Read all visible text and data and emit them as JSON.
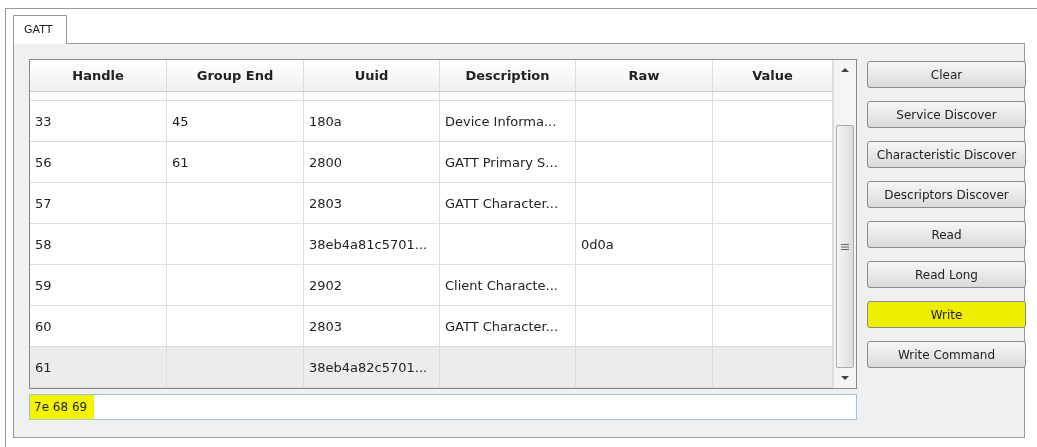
{
  "tabs": [
    {
      "label": "GATT",
      "selected": true
    }
  ],
  "table": {
    "columns": [
      "Handle",
      "Group End",
      "Uuid",
      "Description",
      "Raw",
      "Value"
    ],
    "rows": [
      {
        "cells": [
          "33",
          "45",
          "180a",
          "Device Informa...",
          "",
          ""
        ],
        "selected": false
      },
      {
        "cells": [
          "56",
          "61",
          "2800",
          "GATT Primary S...",
          "",
          ""
        ],
        "selected": false
      },
      {
        "cells": [
          "57",
          "",
          "2803",
          "GATT Character...",
          "",
          ""
        ],
        "selected": false
      },
      {
        "cells": [
          "58",
          "",
          "38eb4a81c5701...",
          "",
          "0d0a",
          ""
        ],
        "selected": false
      },
      {
        "cells": [
          "59",
          "",
          "2902",
          "Client Characte...",
          "",
          ""
        ],
        "selected": false
      },
      {
        "cells": [
          "60",
          "",
          "2803",
          "GATT Character...",
          "",
          ""
        ],
        "selected": false
      },
      {
        "cells": [
          "61",
          "",
          "38eb4a82c5701...",
          "",
          "",
          ""
        ],
        "selected": true
      }
    ]
  },
  "input": {
    "value": "7e 68 69",
    "highlighted": true
  },
  "buttons": [
    {
      "label": "Clear",
      "highlighted": false
    },
    {
      "label": "Service Discover",
      "highlighted": false
    },
    {
      "label": "Characteristic Discover",
      "highlighted": false
    },
    {
      "label": "Descriptors Discover",
      "highlighted": false
    },
    {
      "label": "Read",
      "highlighted": false
    },
    {
      "label": "Read Long",
      "highlighted": false
    },
    {
      "label": "Write",
      "highlighted": true
    },
    {
      "label": "Write Command",
      "highlighted": false
    }
  ]
}
